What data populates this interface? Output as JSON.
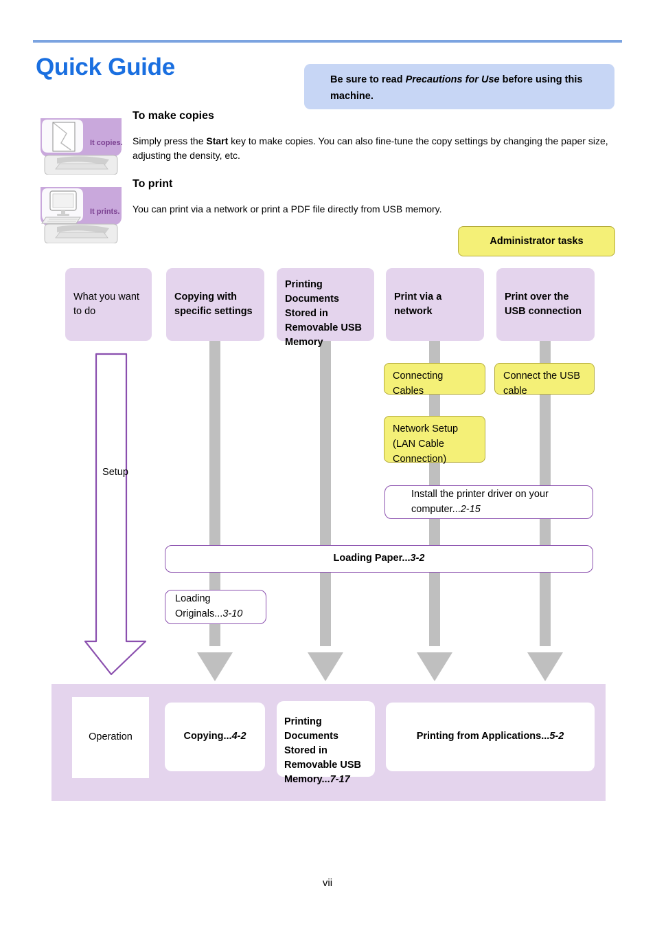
{
  "page": {
    "title": "Quick Guide",
    "folio": "vii",
    "accent_blue": "#1a6fe0",
    "rule_color": "#7ba3e0",
    "callout_bg": "#c7d6f5",
    "lavender": "#e4d4ed",
    "yellow": "#f4f077",
    "purple_outline": "#8a4fae",
    "gray_connector": "#bfbfbf"
  },
  "callout": {
    "before": "Be sure to read ",
    "italic": "Precautions for Use",
    "after": " before using this machine."
  },
  "sections": [
    {
      "icon_label": "It copies.",
      "heading": "To make copies",
      "body_1": "Simply press the ",
      "body_bold": "Start",
      "body_2": " key to make copies. You can also fine-tune the copy settings by changing the paper size, adjusting the density, etc."
    },
    {
      "icon_label": "It prints.",
      "heading": "To print",
      "body_1": "You can print via a network or print a PDF file directly from USB memory.",
      "body_bold": "",
      "body_2": ""
    }
  ],
  "flowchart": {
    "admin_badge": "Administrator tasks",
    "columns": [
      {
        "header": "What you want to do",
        "bold": false
      },
      {
        "header": "Copying with specific settings",
        "bold": true
      },
      {
        "header": "Printing Documents Stored in Removable USB Memory",
        "bold": true
      },
      {
        "header": "Print via a network",
        "bold": true
      },
      {
        "header": "Print over the USB connection",
        "bold": true
      }
    ],
    "row_labels": {
      "setup": "Setup",
      "operation": "Operation"
    },
    "steps": {
      "connecting_cables": "Connecting Cables",
      "network_setup": "Network Setup (LAN Cable Connection)",
      "connect_usb_cable": "Connect the USB cable",
      "install_driver_text": "Install the printer driver on your computer...",
      "install_driver_ref": "2-15",
      "loading_paper_text": "Loading Paper...",
      "loading_paper_ref": "3-2",
      "loading_originals_text": "Loading Originals...",
      "loading_originals_ref": "3-10"
    },
    "operations": {
      "copying_text": "Copying...",
      "copying_ref": "4-2",
      "usb_print_text": "Printing Documents Stored in Removable USB Memory...",
      "usb_print_ref": "7-17",
      "apps_text": "Printing from Applications...",
      "apps_ref": "5-2"
    }
  }
}
